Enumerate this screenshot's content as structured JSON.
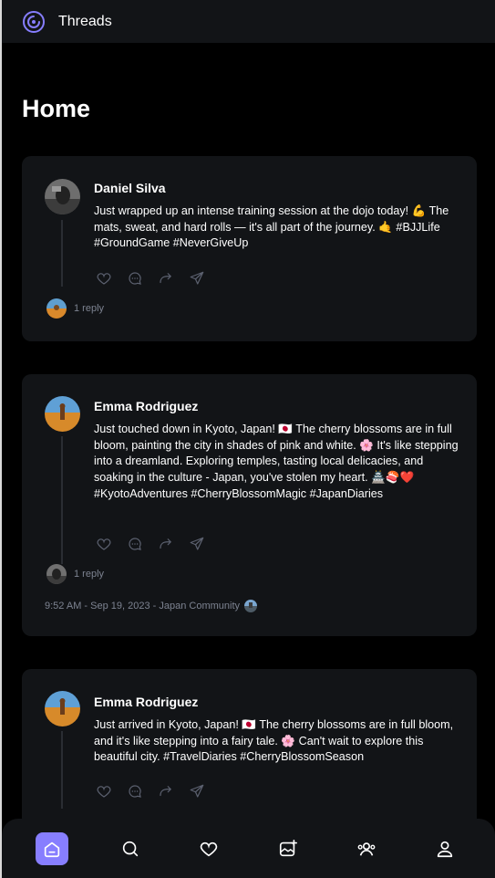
{
  "app": {
    "title": "Threads"
  },
  "page": {
    "title": "Home"
  },
  "threads": [
    {
      "author": "Daniel Silva",
      "text": "Just wrapped up an intense training session at the dojo today! 💪 The mats, sweat, and hard rolls — it's all part of the journey. 🤙 #BJJLife #GroundGame #NeverGiveUp",
      "replies": "1 reply"
    },
    {
      "author": "Emma Rodriguez",
      "text": "Just touched down in Kyoto, Japan! 🇯🇵 The cherry blossoms are in full bloom, painting the city in shades of pink and white. 🌸 It's like stepping into a dreamland. Exploring temples, tasting local delicacies, and soaking in the culture - Japan, you've stolen my heart. 🏯🍣❤️ #KyotoAdventures #CherryBlossomMagic #JapanDiaries",
      "replies": "1 reply",
      "meta": "9:52 AM - Sep 19, 2023 - Japan Community"
    },
    {
      "author": "Emma Rodriguez",
      "text": "Just arrived in Kyoto, Japan! 🇯🇵 The cherry blossoms are in full bloom, and it's like stepping into a fairy tale. 🌸 Can't wait to explore this beautiful city. #TravelDiaries #CherryBlossomSeason"
    }
  ],
  "icons": {
    "logo": "threads-logo-icon",
    "actions": [
      "heart-icon",
      "reply-icon",
      "repost-icon",
      "share-icon"
    ],
    "nav": [
      "home-icon",
      "search-icon",
      "heart-icon",
      "create-thread-icon",
      "communities-icon",
      "profile-icon"
    ]
  },
  "colors": {
    "accent": "#877eff",
    "card": "#121417",
    "muted": "#7d8391",
    "background": "#000000"
  }
}
